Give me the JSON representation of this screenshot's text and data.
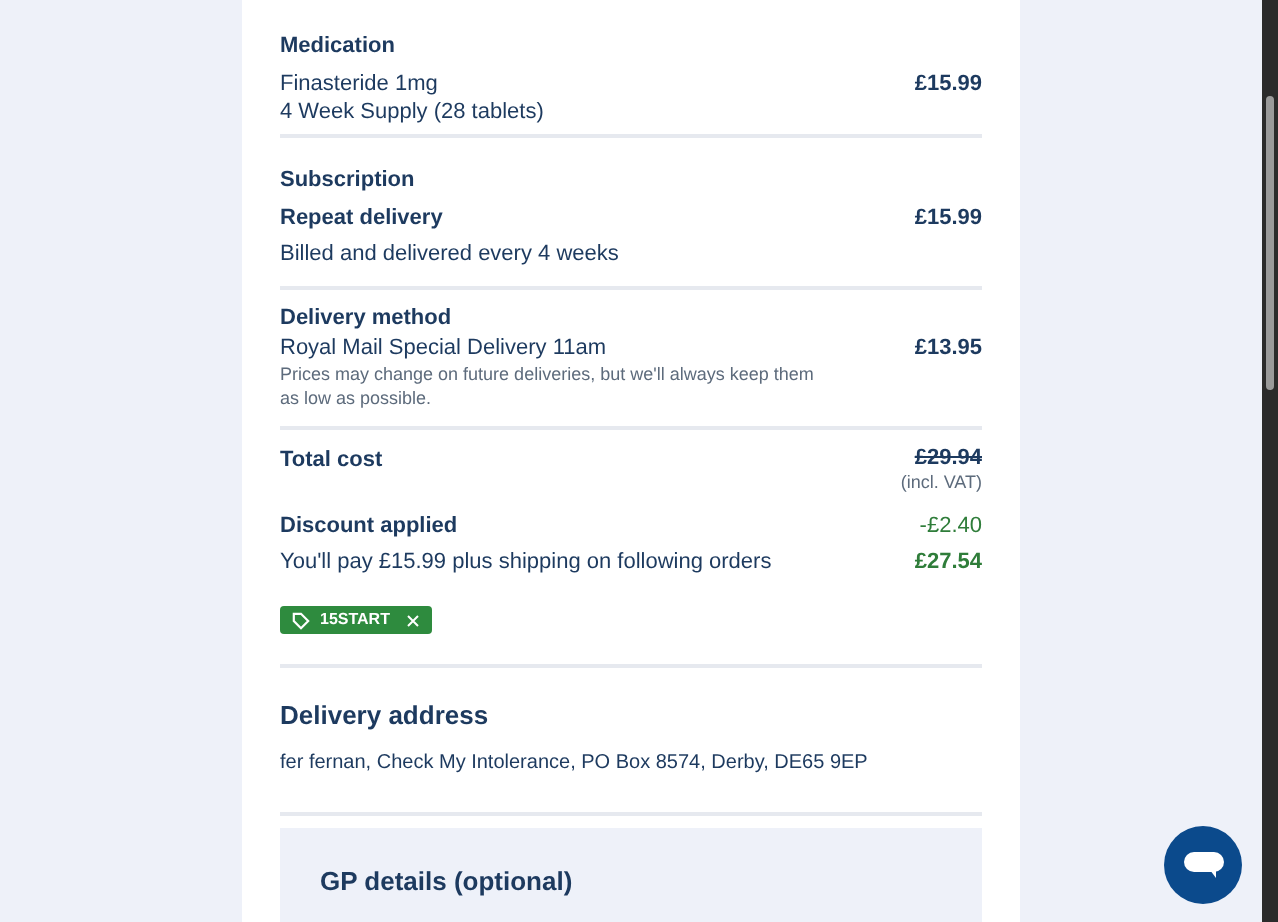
{
  "medication": {
    "heading": "Medication",
    "name": "Finasteride 1mg",
    "supply": "4 Week Supply (28 tablets)",
    "price": "£15.99"
  },
  "subscription": {
    "heading": "Subscription",
    "label": "Repeat delivery",
    "price": "£15.99",
    "note": "Billed and delivered every 4 weeks"
  },
  "delivery_method": {
    "heading": "Delivery method",
    "name": "Royal Mail Special Delivery 11am",
    "price": "£13.95",
    "note": "Prices may change on future deliveries, but we'll always keep them as low as possible."
  },
  "total": {
    "label": "Total cost",
    "price": "£29.94",
    "vat": "(incl. VAT)"
  },
  "discount": {
    "label": "Discount applied",
    "amount": "-£2.40",
    "note": "You'll pay £15.99 plus shipping on following orders",
    "new_total": "£27.54",
    "code": "15START"
  },
  "delivery_address": {
    "heading": "Delivery address",
    "address": "fer fernan, Check My Intolerance, PO Box 8574, Derby, DE65 9EP"
  },
  "gp_details": {
    "heading": "GP details (optional)"
  }
}
